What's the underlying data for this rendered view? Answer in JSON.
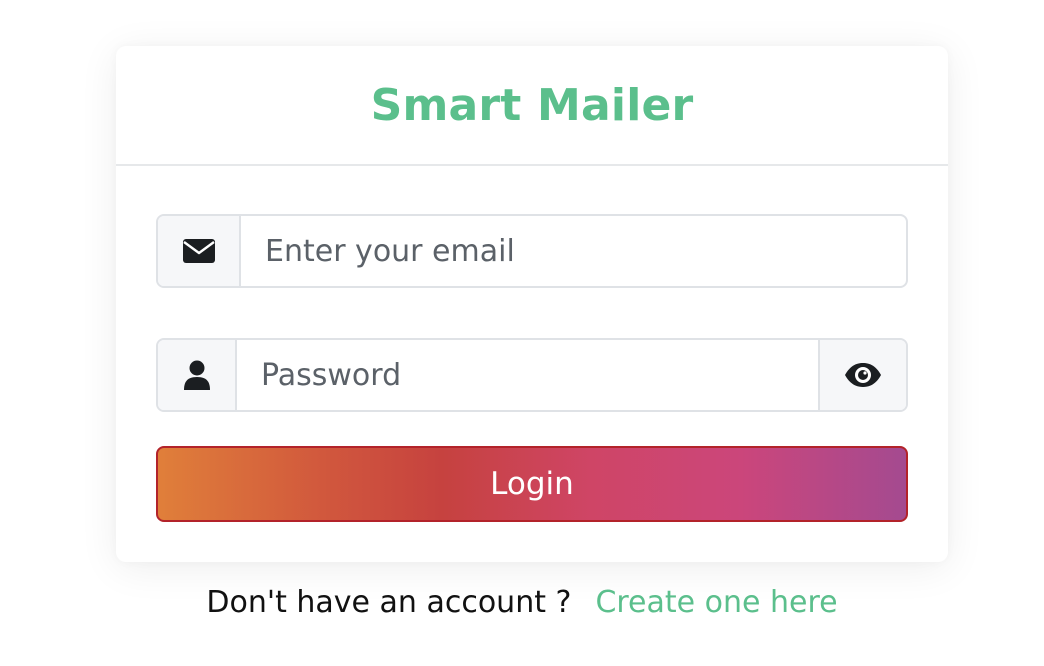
{
  "app": {
    "title": "Smart Mailer"
  },
  "form": {
    "email": {
      "placeholder": "Enter your email",
      "value": "",
      "icon": "envelope-icon"
    },
    "password": {
      "placeholder": "Password",
      "value": "",
      "icon": "user-icon",
      "toggle_icon": "eye-icon"
    },
    "login_label": "Login"
  },
  "footer": {
    "prompt": "Don't have an account ?",
    "link": "Create one here"
  },
  "colors": {
    "accent": "#5bbf8c",
    "button_gradient_start": "#e07f3a",
    "button_gradient_mid": "#c6423f",
    "button_gradient_end": "#a44a90",
    "button_border": "#b3232a"
  }
}
